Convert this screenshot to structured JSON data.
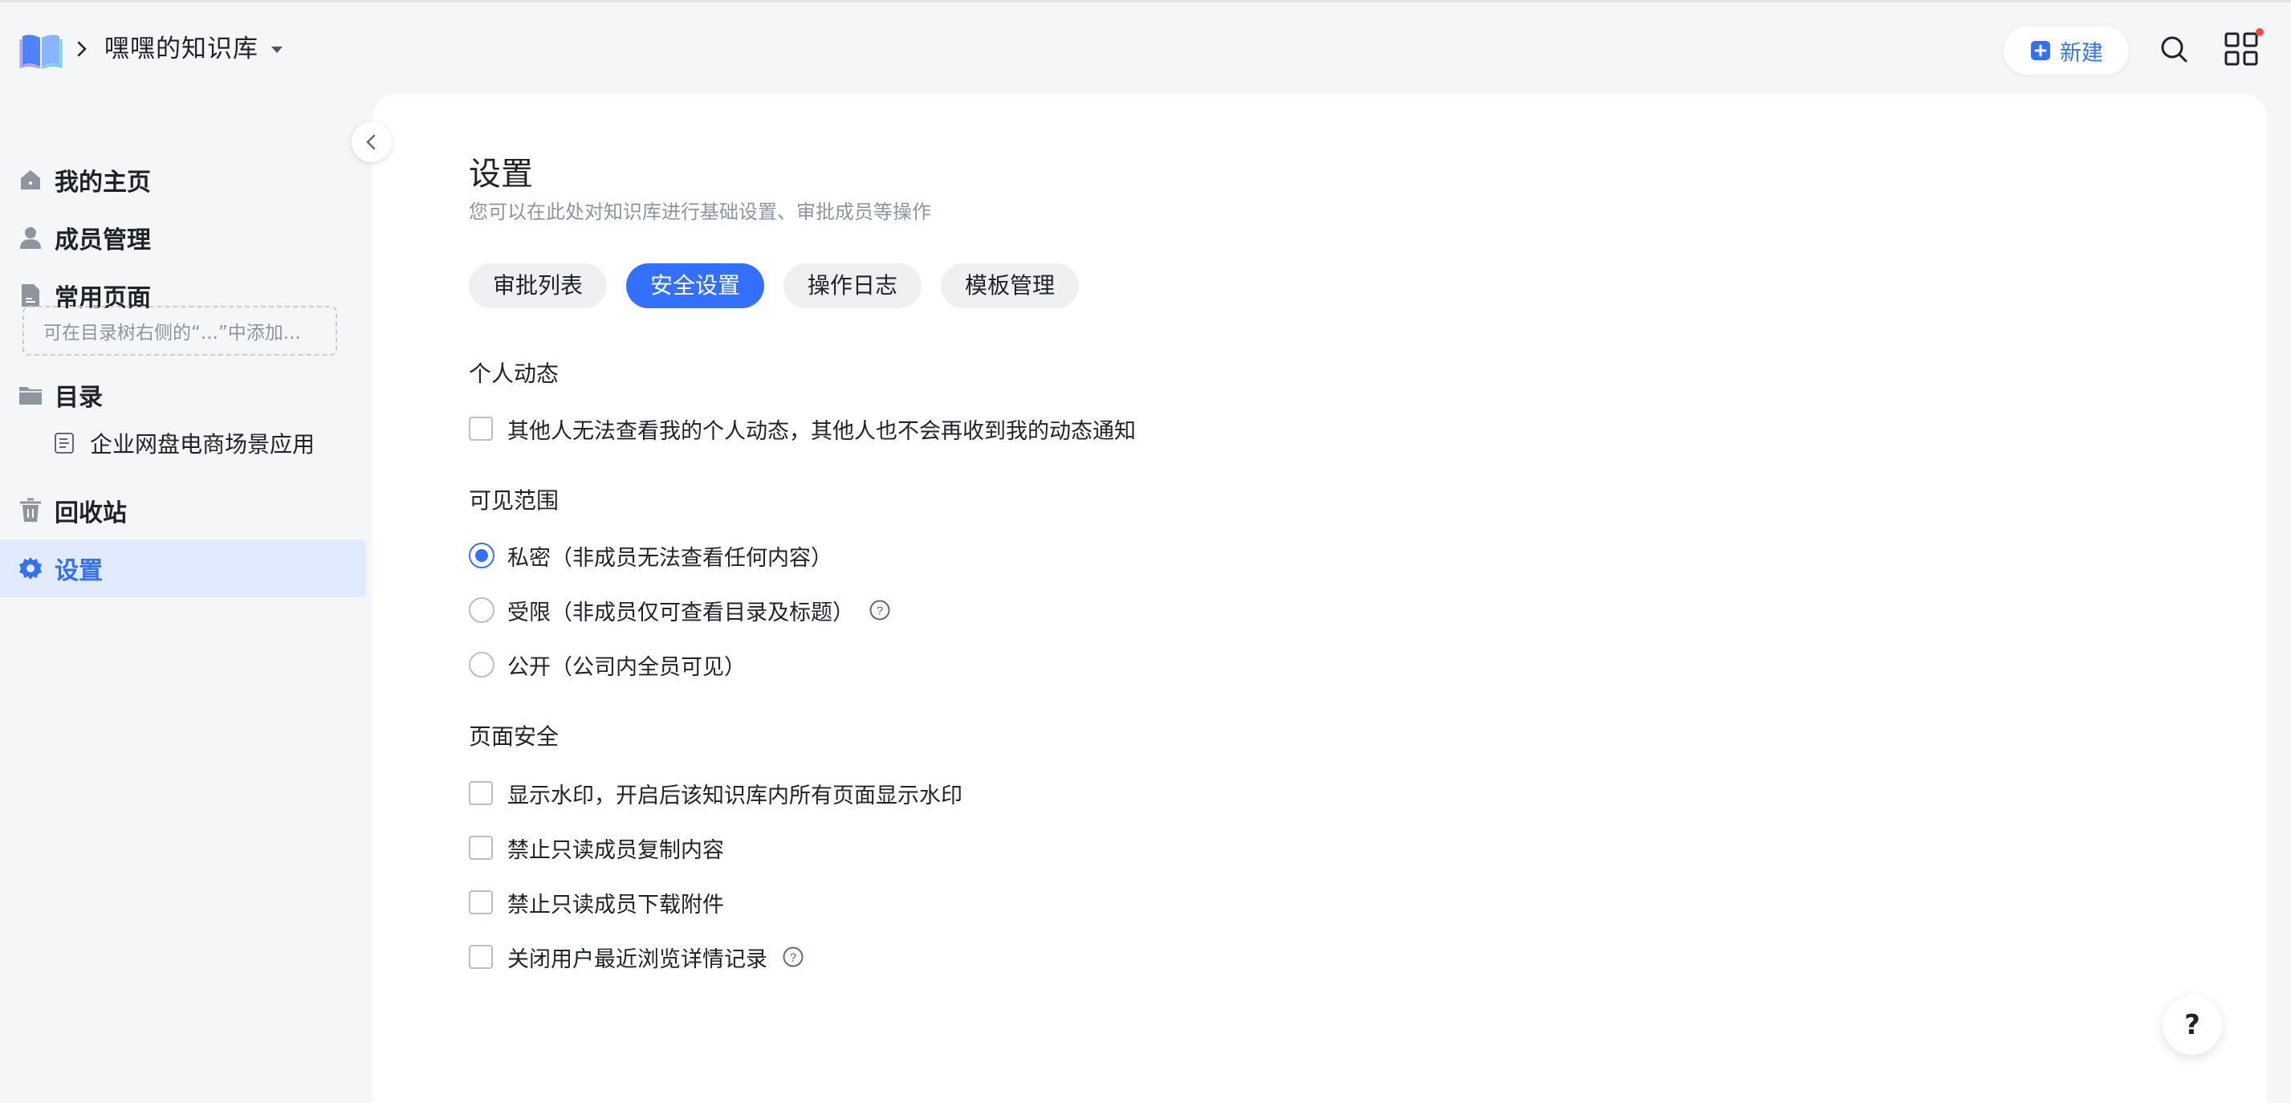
{
  "header": {
    "kb_title": "嘿嘿的知识库",
    "new_button": "新建",
    "accent": "#3370ff",
    "notify_color": "#f54a45"
  },
  "sidebar": {
    "items": [
      {
        "label": "我的主页",
        "icon": "home-icon"
      },
      {
        "label": "成员管理",
        "icon": "person-icon"
      },
      {
        "label": "常用页面",
        "icon": "document-icon"
      },
      {
        "label": "目录",
        "icon": "folder-icon"
      },
      {
        "label": "回收站",
        "icon": "trash-icon"
      },
      {
        "label": "设置",
        "icon": "gear-icon"
      }
    ],
    "frequent_hint": "可在目录树右侧的“...”中添加...",
    "tree": [
      {
        "label": "企业网盘电商场景应用",
        "icon": "doc-outline-icon"
      }
    ],
    "active_item": "设置"
  },
  "main": {
    "title": "设置",
    "subtitle": "您可以在此处对知识库进行基础设置、审批成员等操作",
    "tabs": [
      {
        "label": "审批列表",
        "active": false
      },
      {
        "label": "安全设置",
        "active": true
      },
      {
        "label": "操作日志",
        "active": false
      },
      {
        "label": "模板管理",
        "active": false
      }
    ],
    "personal": {
      "title": "个人动态",
      "options": [
        {
          "label": "其他人无法查看我的个人动态，其他人也不会再收到我的动态通知",
          "checked": false
        }
      ]
    },
    "visibility": {
      "title": "可见范围",
      "options": [
        {
          "label": "私密（非成员无法查看任何内容）",
          "selected": true
        },
        {
          "label": "受限（非成员仅可查看目录及标题）",
          "selected": false
        },
        {
          "label": "公开（公司内全员可见）",
          "selected": false
        }
      ]
    },
    "page_security": {
      "title": "页面安全",
      "options": [
        {
          "label": "显示水印，开启后该知识库内所有页面显示水印",
          "checked": false
        },
        {
          "label": "禁止只读成员复制内容",
          "checked": false
        },
        {
          "label": "禁止只读成员下载附件",
          "checked": false
        },
        {
          "label": "关闭用户最近浏览详情记录",
          "checked": false
        }
      ]
    },
    "help_fab": "?"
  }
}
